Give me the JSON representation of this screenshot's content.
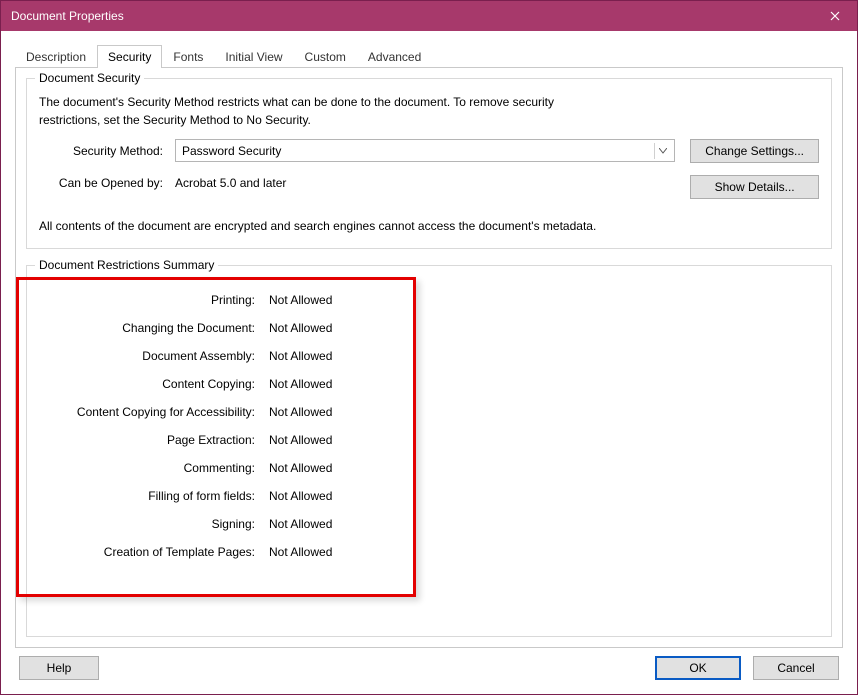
{
  "window": {
    "title": "Document Properties"
  },
  "tabs": {
    "description": "Description",
    "security": "Security",
    "fonts": "Fonts",
    "initial_view": "Initial View",
    "custom": "Custom",
    "advanced": "Advanced"
  },
  "security_group": {
    "legend": "Document Security",
    "description": "The document's Security Method restricts what can be done to the document. To remove security restrictions, set the Security Method to No Security.",
    "method_label": "Security Method:",
    "method_value": "Password Security",
    "change_settings": "Change Settings...",
    "opened_by_label": "Can be Opened by:",
    "opened_by_value": "Acrobat 5.0 and later",
    "show_details": "Show Details...",
    "encrypt_note": "All contents of the document are encrypted and search engines cannot access the document's metadata."
  },
  "restrictions": {
    "legend": "Document Restrictions Summary",
    "items": [
      {
        "label": "Printing:",
        "value": "Not Allowed"
      },
      {
        "label": "Changing the Document:",
        "value": "Not Allowed"
      },
      {
        "label": "Document Assembly:",
        "value": "Not Allowed"
      },
      {
        "label": "Content Copying:",
        "value": "Not Allowed"
      },
      {
        "label": "Content Copying for Accessibility:",
        "value": "Not Allowed"
      },
      {
        "label": "Page Extraction:",
        "value": "Not Allowed"
      },
      {
        "label": "Commenting:",
        "value": "Not Allowed"
      },
      {
        "label": "Filling of form fields:",
        "value": "Not Allowed"
      },
      {
        "label": "Signing:",
        "value": "Not Allowed"
      },
      {
        "label": "Creation of Template Pages:",
        "value": "Not Allowed"
      }
    ]
  },
  "buttons": {
    "help": "Help",
    "ok": "OK",
    "cancel": "Cancel"
  }
}
